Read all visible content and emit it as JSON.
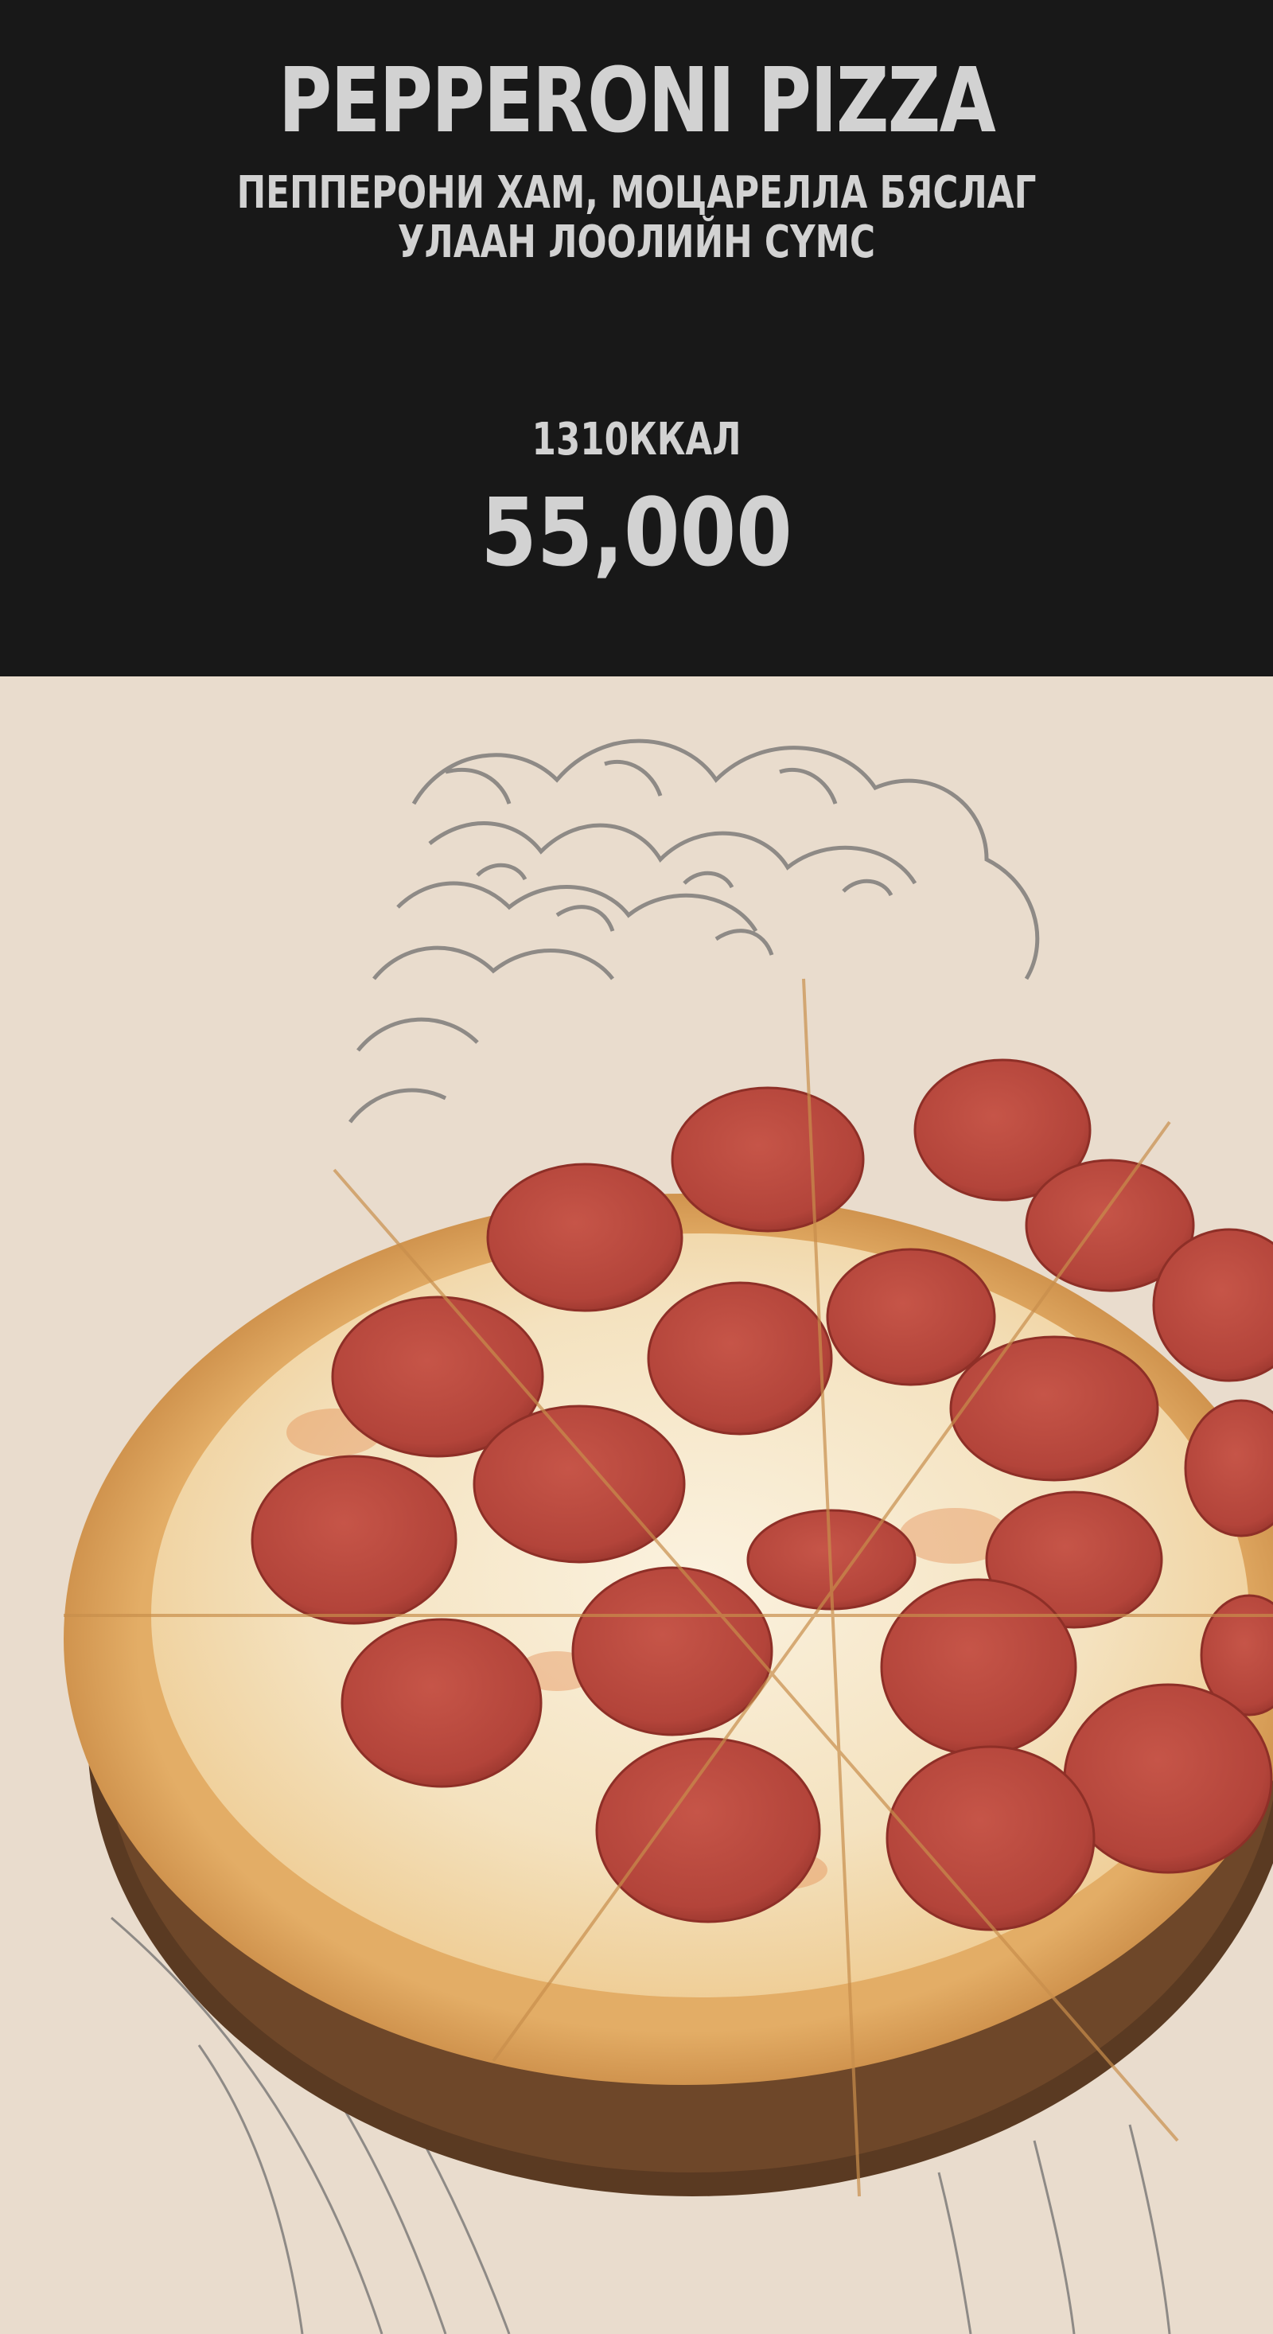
{
  "product": {
    "title": "PEPPERONI PIZZA",
    "description_line1": "ПЕППЕРОНИ ХАМ, МОЦАРЕЛЛА БЯСЛАГ",
    "description_line2": "УЛААН ЛООЛИЙН СҮМС",
    "calories": "1310ККАЛ",
    "price": "55,000"
  },
  "colors": {
    "header_bg": "#181818",
    "header_text": "#d2d2d2",
    "photo_bg": "#e9dccd",
    "pepperoni": "#b8483c",
    "cheese": "#f6ead2",
    "crust": "#d99a52"
  },
  "icons": {
    "decoration": "sketch-illustration"
  }
}
